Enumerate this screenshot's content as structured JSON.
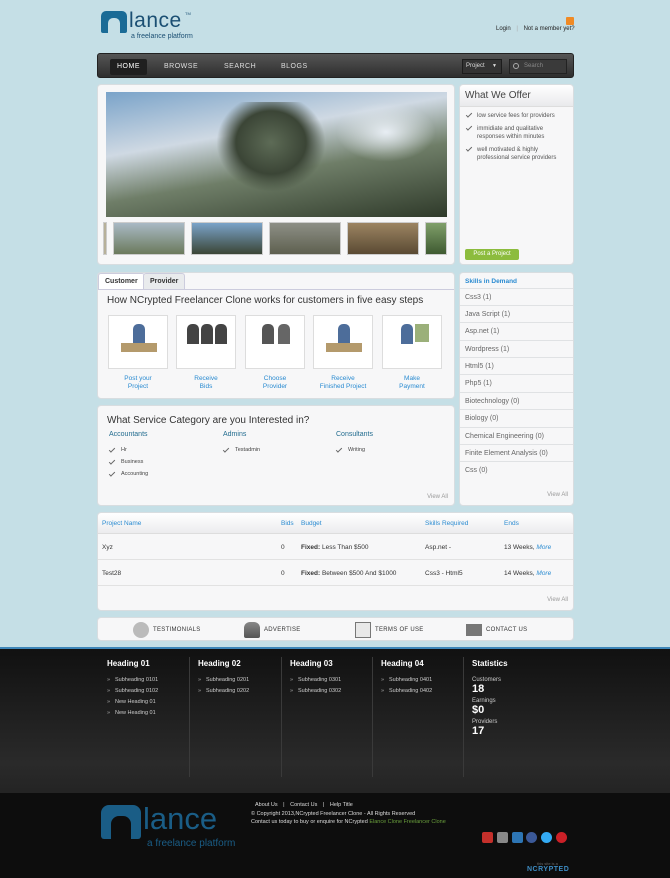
{
  "header": {
    "logo_word": "lance",
    "logo_tm": "TM",
    "logo_tagline": "a freelance platform",
    "login": "Login",
    "not_member": "Not a member yet?"
  },
  "nav": {
    "items": [
      "HOME",
      "BROWSE",
      "SEARCH",
      "BLOGS"
    ],
    "select_value": "Project",
    "search_placeholder": "Search"
  },
  "offer": {
    "title": "What We Offer",
    "items": [
      "low service fees for providers",
      "immidiate and qualitative responses within minutes",
      "well motivated & highly professional service providers"
    ],
    "button": "Post a Project"
  },
  "steps": {
    "tabs": [
      "Customer",
      "Provider"
    ],
    "title": "How NCrypted Freelancer Clone works for customers in five easy steps",
    "items": [
      {
        "line1": "Post your",
        "line2": "Project"
      },
      {
        "line1": "Receive",
        "line2": "Bids"
      },
      {
        "line1": "Choose",
        "line2": "Provider"
      },
      {
        "line1": "Receive",
        "line2": "Finished Project"
      },
      {
        "line1": "Make",
        "line2": "Payment"
      }
    ]
  },
  "service": {
    "title": "What Service Category are you Interested in?",
    "categories": [
      {
        "name": "Accountants",
        "items": [
          "Hr",
          "Business",
          "Accounting"
        ]
      },
      {
        "name": "Admins",
        "items": [
          "Testadmin"
        ]
      },
      {
        "name": "Consultants",
        "items": [
          "Writing"
        ]
      }
    ],
    "view_all": "View All"
  },
  "skills": {
    "title": "Skills in Demand",
    "items": [
      "Css3 (1)",
      "Java Script (1)",
      "Asp.net (1)",
      "Wordpress (1)",
      "Html5 (1)",
      "Php5 (1)",
      "Biotechnology (0)",
      "Biology (0)",
      "Chemical Engineering (0)",
      "Finite Element Analysis (0)",
      "Css (0)"
    ],
    "view_all": "View All"
  },
  "projects": {
    "headers": {
      "name": "Project Name",
      "bids": "Bids",
      "budget": "Budget",
      "skills": "Skills Required",
      "ends": "Ends"
    },
    "rows": [
      {
        "name": "Xyz",
        "bids": "0",
        "budget_label": "Fixed:",
        "budget": "Less Than $500",
        "skills": "Asp.net -",
        "ends": "13 Weeks,",
        "more": "More"
      },
      {
        "name": "Test28",
        "bids": "0",
        "budget_label": "Fixed:",
        "budget": "Between $500 And $1000",
        "skills": "Css3 - Html5",
        "ends": "14 Weeks,",
        "more": "More"
      }
    ],
    "view_all": "View All"
  },
  "footer_links": [
    "TESTIMONIALS",
    "ADVERTISE",
    "TERMS OF USE",
    "CONTACT US"
  ],
  "footer": {
    "columns": [
      {
        "heading": "Heading 01",
        "items": [
          "Subheading 0101",
          "Subheading 0102",
          "New Heading 01",
          "New Heading 01"
        ]
      },
      {
        "heading": "Heading 02",
        "items": [
          "Subheading 0201",
          "Subheading 0202"
        ]
      },
      {
        "heading": "Heading 03",
        "items": [
          "Subheading 0301",
          "Subheading 0302"
        ]
      },
      {
        "heading": "Heading 04",
        "items": [
          "Subheading 0401",
          "Subheading 0402"
        ]
      }
    ],
    "stats": {
      "heading": "Statistics",
      "customers_label": "Customers",
      "customers": "18",
      "earnings_label": "Earnings",
      "earnings": "$0",
      "providers_label": "Providers",
      "providers": "17"
    },
    "menu": [
      "About Us",
      "Contact Us",
      "Help Title"
    ],
    "copyright": "© Copyright 2013,NCrypted Freelancer Clone - All Rights Reserved",
    "contact_text": "Contact us today to buy or enquire for NCrypted",
    "contact_link": "Elance Clone Freelancer Clone",
    "badge_small": "this site is a",
    "badge": "NCRYPTED"
  },
  "colors": {
    "accent": "#2a8bd1",
    "brand": "#1b4f73",
    "green": "#8cbc3e"
  }
}
